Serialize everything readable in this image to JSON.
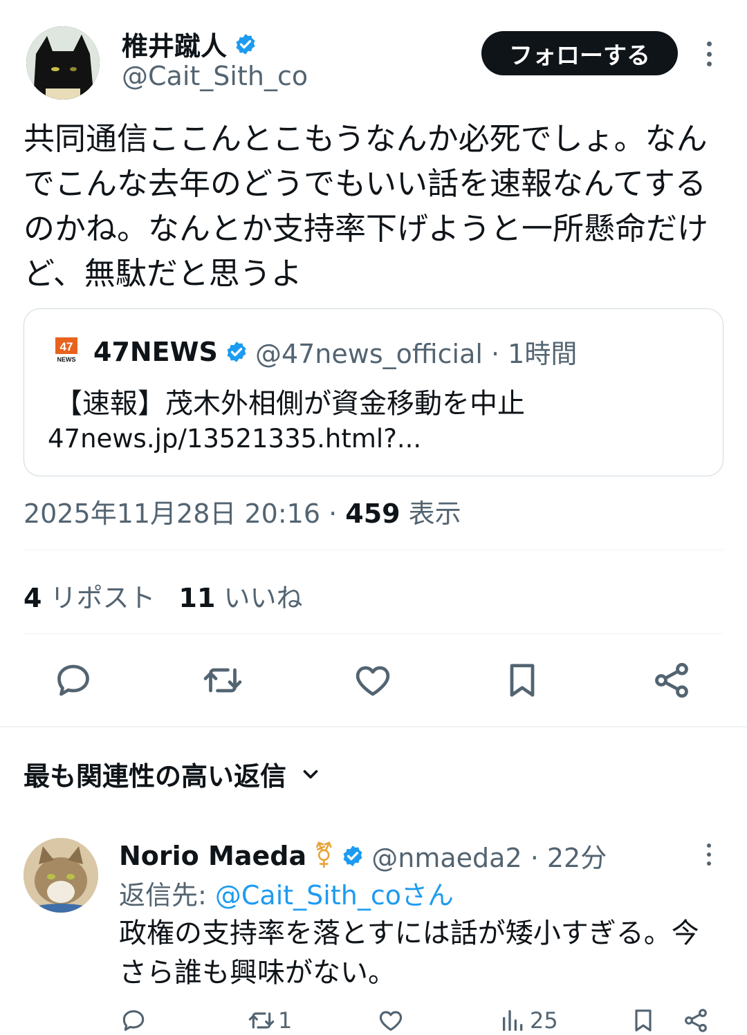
{
  "author": {
    "name": "椎井蹴人",
    "handle": "@Cait_Sith_co",
    "verified": true
  },
  "follow_button_label": "フォローする",
  "tweet_text": "共同通信ここんとこもうなんか必死でしょ。なんでこんな去年のどうでもいい話を速報なんてするのかね。なんとか支持率下げようと一所懸命だけど、無駄だと思うよ",
  "quote": {
    "logo_text": "47",
    "logo_subtext": "NEWS",
    "name": "47NEWS",
    "handle_time": "@47news_official · 1時間",
    "headline": "【速報】茂木外相側が資金移動を中止",
    "link": "47news.jp/13521335.html?..."
  },
  "meta": {
    "datetime": "2025年11月28日 20:16 · ",
    "views_count": "459",
    "views_label": " 表示"
  },
  "stats": {
    "reposts_count": "4",
    "reposts_label": " リポスト",
    "likes_count": "11",
    "likes_label": " いいね"
  },
  "action_icons": [
    "reply-icon",
    "repost-icon",
    "like-icon",
    "bookmark-icon",
    "share-icon"
  ],
  "replies_sort_label": "最も関連性の高い返信",
  "reply": {
    "name": "Norio Maeda",
    "emoji": "⚧",
    "handle_time": "@nmaeda2 · 22分",
    "reply_to_prefix": "返信先: ",
    "reply_to_target": "@Cait_Sith_coさん",
    "text": "政権の支持率を落とすには話が矮小すぎる。今さら誰も興味がない。",
    "repost_count": "1",
    "views_count": "25"
  },
  "colors": {
    "text": "#0f1419",
    "secondary": "#536471",
    "accent": "#1d9bf0",
    "border": "#cfd9de"
  }
}
